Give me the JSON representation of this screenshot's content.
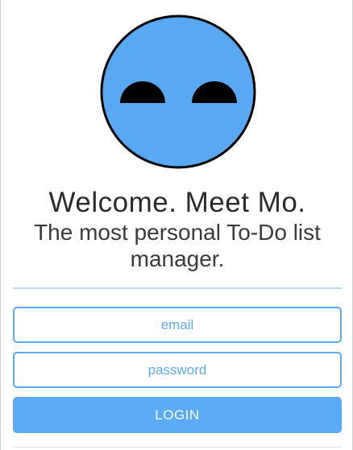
{
  "mascot": {
    "icon": "mo-face-icon",
    "face_color": "#58a8f4",
    "eye_color": "#000000"
  },
  "heading": {
    "title": "Welcome. Meet Mo.",
    "subtitle": "The most personal To-Do list manager."
  },
  "form": {
    "email_placeholder": "email",
    "password_placeholder": "password",
    "login_label": "LOGIN"
  },
  "colors": {
    "accent": "#5aaaf4",
    "divider": "#bcdaf3"
  }
}
